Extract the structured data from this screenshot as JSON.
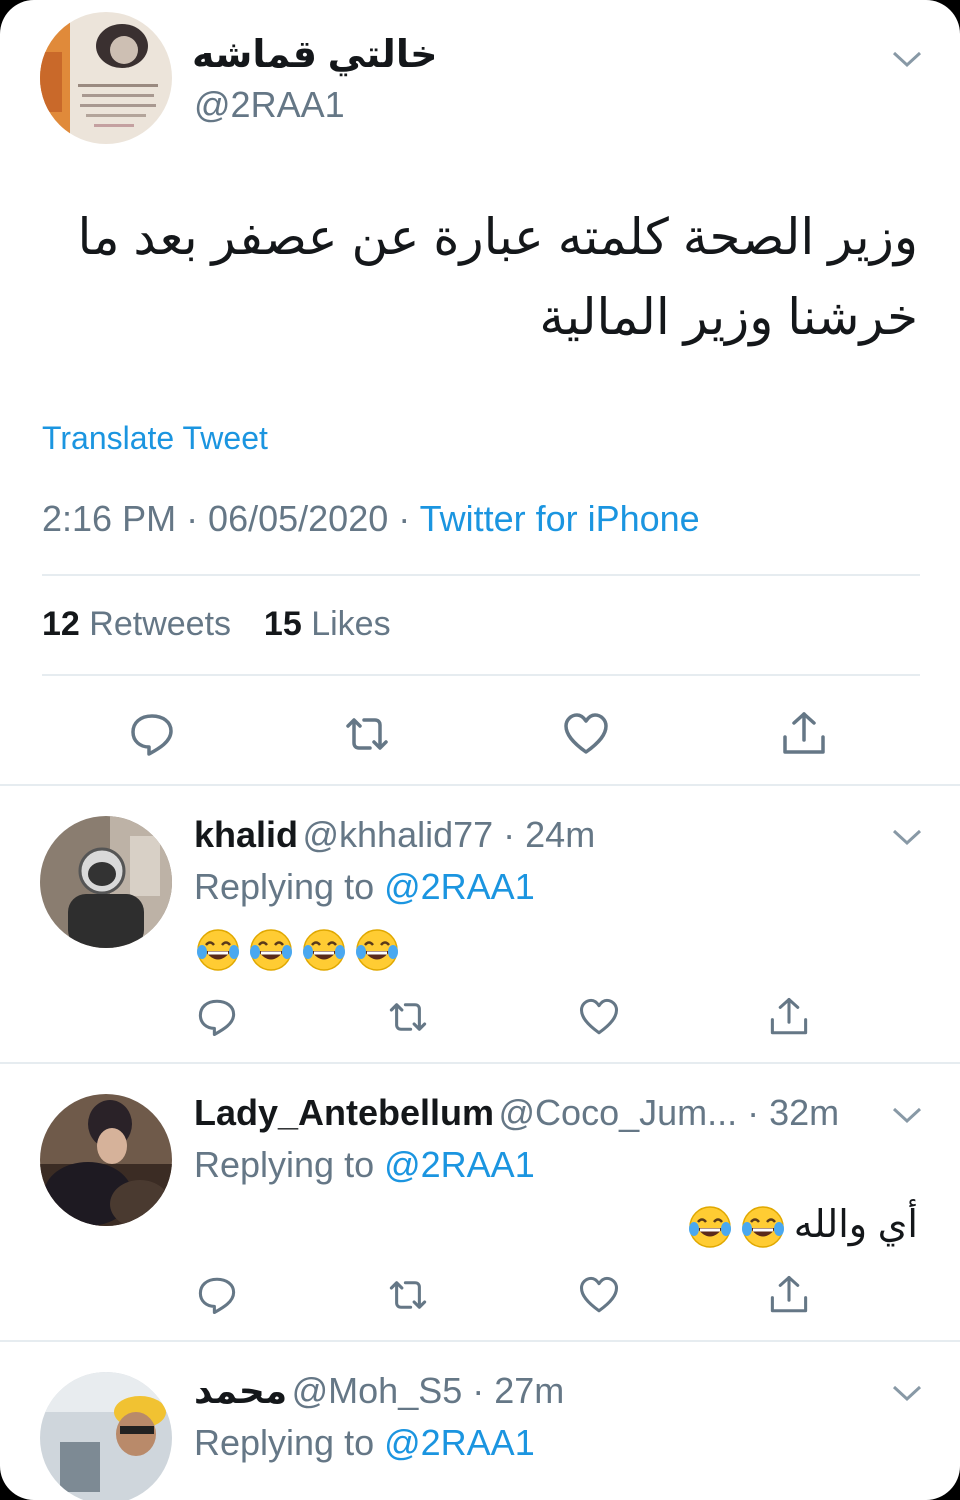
{
  "tweet": {
    "author_name": "خالتي قماشه",
    "author_handle": "@2RAA1",
    "text_line1": "وزير الصحة كلمته عبارة عن عصفر بعد ما",
    "text_line2": "خرشنا وزير المالية",
    "translate_label": "Translate Tweet",
    "timestamp": "2:16 PM · 06/05/2020 · ",
    "source": "Twitter for iPhone",
    "retweets_count": "12",
    "retweets_label": "Retweets",
    "likes_count": "15",
    "likes_label": "Likes"
  },
  "replies": [
    {
      "name": "khalid",
      "handle": "@khhalid77",
      "time": " · 24m",
      "replying_label": "Replying to ",
      "replying_to": "@2RAA1",
      "emoji_count": 4,
      "text": ""
    },
    {
      "name": "Lady_Antebellum",
      "handle": "@Coco_Jum...",
      "time": " · 32m",
      "replying_label": "Replying to ",
      "replying_to": "@2RAA1",
      "text": "أي والله",
      "emoji_count": 2
    },
    {
      "name": "محمد",
      "handle": "@Moh_S5",
      "time": " · 27m",
      "replying_label": "Replying to ",
      "replying_to": "@2RAA1",
      "text": "",
      "emoji_count": 0
    }
  ],
  "icons": {
    "reply": "reply-icon",
    "retweet": "retweet-icon",
    "like": "heart-icon",
    "share": "share-icon",
    "more": "chevron-down-icon",
    "emoji": "face-with-tears-of-joy-icon"
  },
  "colors": {
    "link": "#1b95e0",
    "secondary_text": "#657786",
    "primary_text": "#14171a",
    "divider": "#e6ecf0"
  }
}
